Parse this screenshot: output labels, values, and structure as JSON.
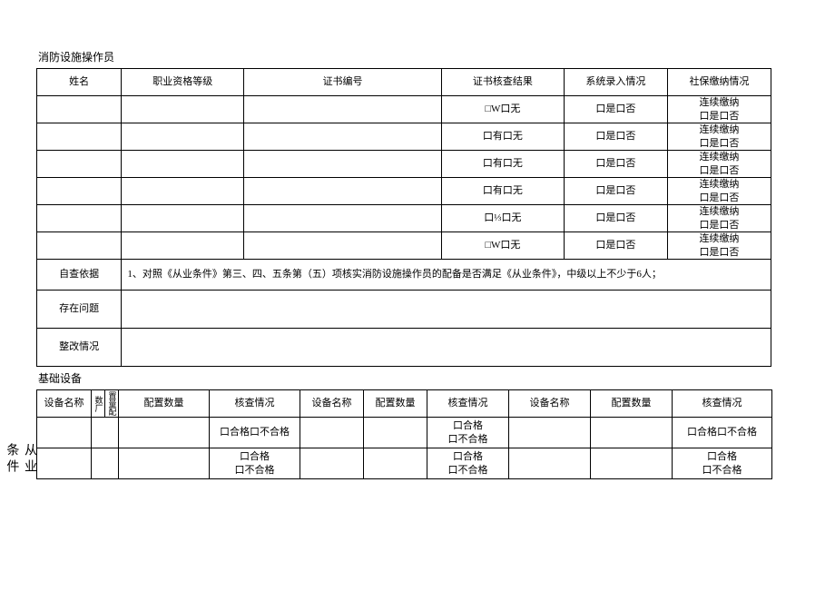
{
  "sideLabel": "从业条件",
  "section1": {
    "title": "消防设施操作员",
    "headers": {
      "name": "姓名",
      "qualLevel": "职业资格等级",
      "certNo": "证书编号",
      "certCheck": "证书核查结果",
      "sysEntry": "系统录入情况",
      "social": "社保缴纳情况"
    },
    "rows": [
      {
        "name": "",
        "qualLevel": "",
        "certNo": "",
        "certCheck": "□W口无",
        "sysEntry": "口是口否",
        "social1": "连续缴纳",
        "social2": "口是口否"
      },
      {
        "name": "",
        "qualLevel": "",
        "certNo": "",
        "certCheck": "口有口无",
        "sysEntry": "口是口否",
        "social1": "连续缴纳",
        "social2": "口是口否"
      },
      {
        "name": "",
        "qualLevel": "",
        "certNo": "",
        "certCheck": "口有口无",
        "sysEntry": "口是口否",
        "social1": "连续缴纳",
        "social2": "口是口否"
      },
      {
        "name": "",
        "qualLevel": "",
        "certNo": "",
        "certCheck": "口有口无",
        "sysEntry": "口是口否",
        "social1": "连续缴纳",
        "social2": "口是口否"
      },
      {
        "name": "",
        "qualLevel": "",
        "certNo": "",
        "certCheck": "口⅓口无",
        "sysEntry": "口是口否",
        "social1": "连续缴纳",
        "social2": "口是口否"
      },
      {
        "name": "",
        "qualLevel": "",
        "certNo": "",
        "certCheck": "□W口无",
        "sysEntry": "口是口否",
        "social1": "连续缴纳",
        "social2": "口是口否"
      }
    ],
    "basisLabel": "自查依据",
    "basisText": "1、对照《从业条件》第三、四、五条第（五）项核实消防设施操作员的配备是否满足《从业条件》，中级以上不少于6人；",
    "issuesLabel": "存在问题",
    "issuesText": "",
    "rectifyLabel": "整改情况",
    "rectifyText": ""
  },
  "section2": {
    "title": "基础设备",
    "headers": {
      "equipName": "设备名称",
      "cfgQtyVert1": "数厂",
      "cfgQtyVert2": "置量配",
      "cfgQty": "配置数量",
      "checkStatus": "核查情况"
    },
    "rows": [
      {
        "c1": "",
        "c2": "",
        "c3": "",
        "c4": "口合格口不合格",
        "c5": "",
        "c6": "",
        "c7a": "口合格",
        "c7b": "口不合格",
        "c8": "",
        "c9": "",
        "c10": "口合格口不合格"
      },
      {
        "c1": "",
        "c2": "",
        "c3": "",
        "c4a": "口合格",
        "c4b": "口不合格",
        "c5": "",
        "c6": "",
        "c7a": "口合格",
        "c7b": "口不合格",
        "c8": "",
        "c9": "",
        "c10a": "口合格",
        "c10b": "口不合格"
      }
    ]
  }
}
